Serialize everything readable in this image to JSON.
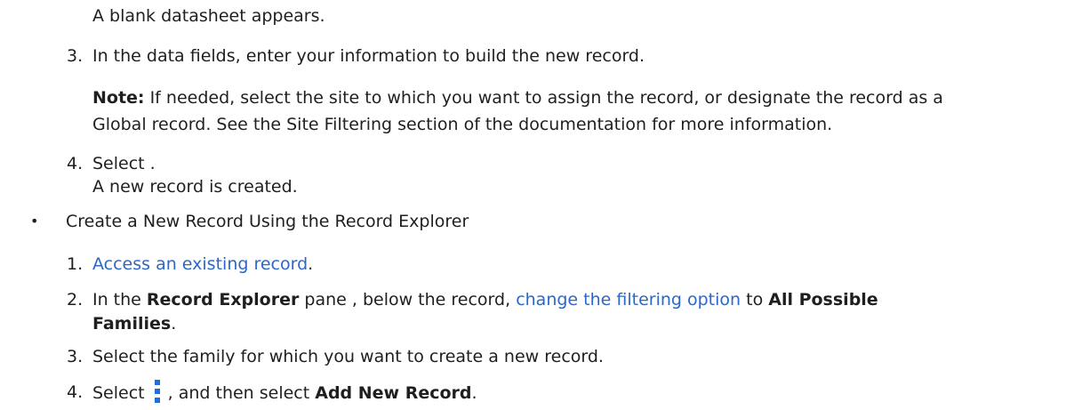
{
  "doc": {
    "intro_result": "A blank datasheet appears.",
    "step3": {
      "num": "3.",
      "text": "In the data fields, enter your information to build the new record."
    },
    "note": {
      "label": "Note:",
      "line1": " If needed, select the site to which you want to assign the record, or designate the record as a",
      "line2": "Global record. See the Site Filtering section of the documentation for more information."
    },
    "step4": {
      "num": "4.",
      "text": "Select .",
      "result": "A new record is created."
    },
    "bullet": {
      "symbol": "•",
      "text": "Create a New Record Using the Record Explorer"
    },
    "sub_steps": {
      "s1": {
        "num": "1.",
        "link": "Access an existing record",
        "after": "."
      },
      "s2": {
        "num": "2.",
        "pre": "In the ",
        "bold1": "Record Explorer",
        "mid": " pane , below the record, ",
        "link": "change the filtering option",
        "post": " to ",
        "bold2a": "All Possible",
        "bold2b": "Families",
        "end": "."
      },
      "s3": {
        "num": "3.",
        "text": "Select the family for which you want to create a new record."
      },
      "s4": {
        "num": "4.",
        "pre": "Select",
        "icon": "kebab-menu-icon",
        "mid": ", and then select ",
        "bold": "Add New Record",
        "end": "."
      }
    },
    "colors": {
      "text": "#1f1f1f",
      "link": "#2b67c8",
      "icon": "#1e6fd9"
    }
  }
}
